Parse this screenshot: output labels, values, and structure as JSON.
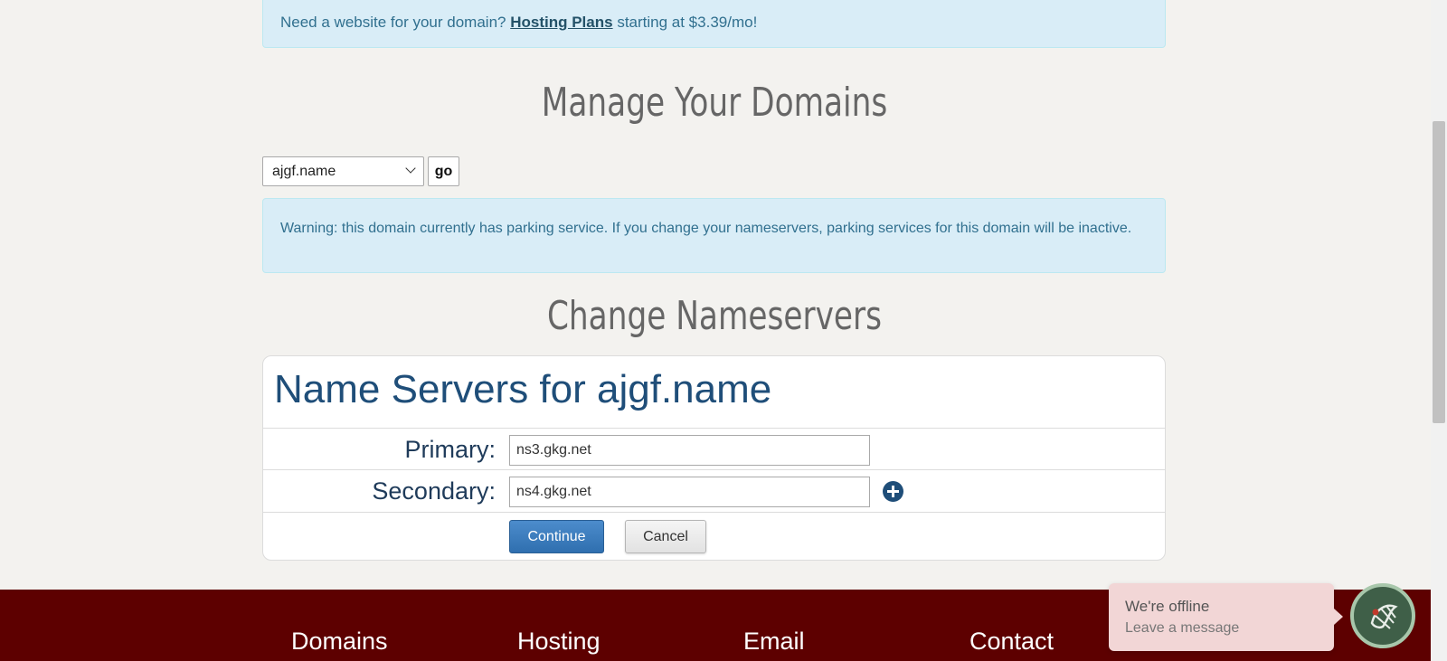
{
  "promo": {
    "text_before": "Need a website for your domain?",
    "link": "Hosting Plans",
    "text_after": "starting at $3.39/mo!"
  },
  "manage": {
    "heading": "Manage Your Domains",
    "selected_domain": "ajgf.name",
    "go_label": "go"
  },
  "warning": {
    "text": "Warning: this domain currently has parking service. If you change your nameservers, parking services for this domain will be inactive."
  },
  "change": {
    "heading": "Change Nameservers"
  },
  "nameservers": {
    "title": "Name Servers for ajgf.name",
    "primary_label": "Primary:",
    "primary_value": "ns3.gkg.net",
    "secondary_label": "Secondary:",
    "secondary_value": "ns4.gkg.net",
    "continue_label": "Continue",
    "cancel_label": "Cancel"
  },
  "footer": {
    "links": [
      "Domains",
      "Hosting",
      "Email",
      "Contact"
    ]
  },
  "chat": {
    "status": "We're offline",
    "subtext": "Leave a message"
  },
  "colors": {
    "alert_bg": "#d9edf7",
    "footer_bg": "#5d0000",
    "primary_button": "#2f6faf",
    "title_blue": "#1f4e79"
  }
}
